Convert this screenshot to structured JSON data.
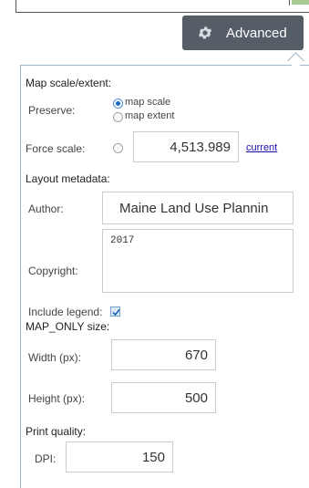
{
  "toolbar": {
    "advanced_label": "Advanced",
    "advanced_icon": "gear-icon"
  },
  "map_scale": {
    "title": "Map scale/extent:",
    "preserve_label": "Preserve:",
    "options": [
      {
        "label": "map scale",
        "checked": true
      },
      {
        "label": "map extent",
        "checked": false
      }
    ],
    "force_scale_label": "Force scale:",
    "force_scale_checked": false,
    "force_scale_value": "4,513.989",
    "current_link": "current"
  },
  "layout_metadata": {
    "title": "Layout metadata:",
    "author_label": "Author:",
    "author_value": "Maine Land Use Plannin",
    "copyright_label": "Copyright:",
    "copyright_value": "2017",
    "include_legend_label": "Include legend:",
    "include_legend_checked": true
  },
  "map_only_size": {
    "title": "MAP_ONLY size:",
    "width_label": "Width (px):",
    "width_value": "670",
    "height_label": "Height (px):",
    "height_value": "500"
  },
  "print_quality": {
    "title": "Print quality:",
    "dpi_label": "DPI:",
    "dpi_value": "150"
  },
  "colors": {
    "button_bg": "#555e66",
    "panel_border": "#9fb7c8",
    "accent": "#1b6ac9"
  }
}
